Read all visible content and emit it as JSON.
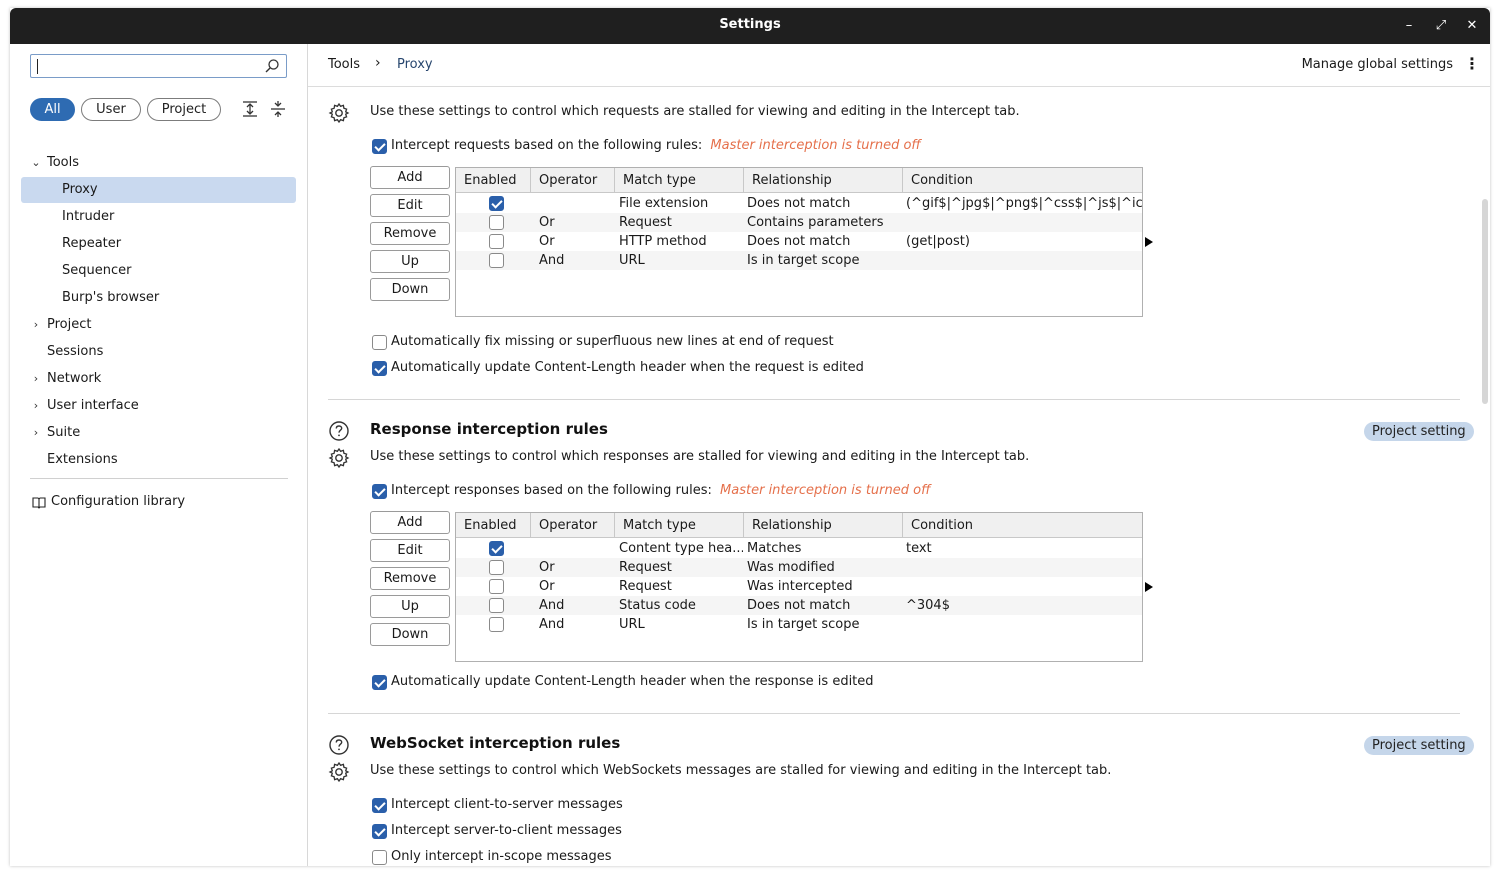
{
  "window": {
    "title": "Settings",
    "minimize": "–",
    "maximize": "⤢",
    "close": "✕"
  },
  "sidebar": {
    "search": {
      "value": "",
      "placeholder": ""
    },
    "filters": [
      "All",
      "User",
      "Project"
    ],
    "tree": [
      {
        "label": "Tools",
        "chevron": "⌄"
      },
      {
        "label": "Proxy"
      },
      {
        "label": "Intruder"
      },
      {
        "label": "Repeater"
      },
      {
        "label": "Sequencer"
      },
      {
        "label": "Burp's browser"
      },
      {
        "label": "Project",
        "chevron": "›"
      },
      {
        "label": "Sessions"
      },
      {
        "label": "Network",
        "chevron": "›"
      },
      {
        "label": "User interface",
        "chevron": "›"
      },
      {
        "label": "Suite",
        "chevron": "›"
      },
      {
        "label": "Extensions"
      }
    ],
    "config_library": "Configuration library"
  },
  "breadcrumb": {
    "root": "Tools",
    "separator": "›",
    "current": "Proxy"
  },
  "manage_global": "Manage global settings",
  "request_section": {
    "description": "Use these settings to control which requests are stalled for viewing and editing in the Intercept tab.",
    "intercept_label": "Intercept requests based on the following rules:",
    "warning": "Master interception is turned off",
    "buttons": [
      "Add",
      "Edit",
      "Remove",
      "Up",
      "Down"
    ],
    "columns": [
      "Enabled",
      "Operator",
      "Match type",
      "Relationship",
      "Condition"
    ],
    "rows": [
      {
        "enabled": true,
        "operator": "",
        "match": "File extension",
        "rel": "Does not match",
        "cond": "(^gif$|^jpg$|^png$|^css$|^js$|^ico$|..."
      },
      {
        "enabled": false,
        "operator": "Or",
        "match": "Request",
        "rel": "Contains parameters",
        "cond": ""
      },
      {
        "enabled": false,
        "operator": "Or",
        "match": "HTTP method",
        "rel": "Does not match",
        "cond": "(get|post)"
      },
      {
        "enabled": false,
        "operator": "And",
        "match": "URL",
        "rel": "Is in target scope",
        "cond": ""
      }
    ],
    "fix_newlines": "Automatically fix missing or superfluous new lines at end of request",
    "update_length": "Automatically update Content-Length header when the request is edited"
  },
  "response_section": {
    "title": "Response interception rules",
    "badge": "Project setting",
    "description": "Use these settings to control which responses are stalled for viewing and editing in the Intercept tab.",
    "intercept_label": "Intercept responses based on the following rules:",
    "warning": "Master interception is turned off",
    "buttons": [
      "Add",
      "Edit",
      "Remove",
      "Up",
      "Down"
    ],
    "columns": [
      "Enabled",
      "Operator",
      "Match type",
      "Relationship",
      "Condition"
    ],
    "rows": [
      {
        "enabled": true,
        "operator": "",
        "match": "Content type hea...",
        "rel": "Matches",
        "cond": "text"
      },
      {
        "enabled": false,
        "operator": "Or",
        "match": "Request",
        "rel": "Was modified",
        "cond": ""
      },
      {
        "enabled": false,
        "operator": "Or",
        "match": "Request",
        "rel": "Was intercepted",
        "cond": ""
      },
      {
        "enabled": false,
        "operator": "And",
        "match": "Status code",
        "rel": "Does not match",
        "cond": "^304$"
      },
      {
        "enabled": false,
        "operator": "And",
        "match": "URL",
        "rel": "Is in target scope",
        "cond": ""
      }
    ],
    "update_length": "Automatically update Content-Length header when the response is edited"
  },
  "websocket_section": {
    "title": "WebSocket interception rules",
    "badge": "Project setting",
    "description": "Use these settings to control which WebSockets messages are stalled for viewing and editing in the Intercept tab.",
    "client_to_server": "Intercept client-to-server messages",
    "server_to_client": "Intercept server-to-client messages",
    "in_scope": "Only intercept in-scope messages"
  },
  "colors": {
    "accent": "#2e6bb2",
    "selected": "#c9d9ef",
    "warning": "#e5704b",
    "badge": "#c5d6ea",
    "titlebar": "#1f1f1f"
  }
}
